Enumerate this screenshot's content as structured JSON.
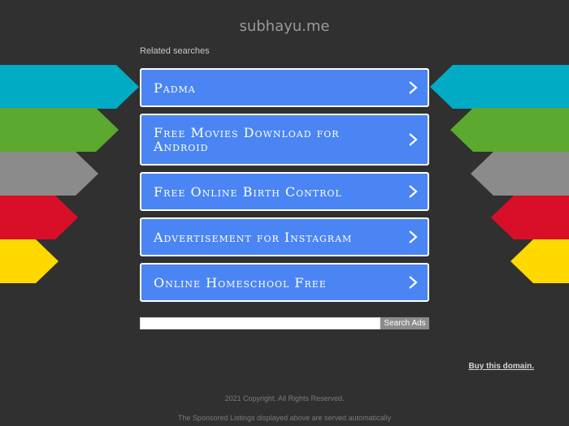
{
  "site": {
    "title": "subhayu.me"
  },
  "related": {
    "heading": "Related searches",
    "items": [
      {
        "label": "Padma"
      },
      {
        "label": "Free Movies Download for Android"
      },
      {
        "label": "Free Online Birth Control"
      },
      {
        "label": "Advertisement for Instagram"
      },
      {
        "label": "Online Homeschool Free"
      }
    ]
  },
  "decor": {
    "arrow_colors": [
      "#00abc3",
      "#5ba92f",
      "#8b8b8b",
      "#d90f2a",
      "#ffd800"
    ]
  },
  "search": {
    "value": "",
    "button_label": "Search Ads"
  },
  "footer": {
    "buy_link": "Buy this domain.",
    "copyright": "2021 Copyright. All Rights Reserved.",
    "disclaimer": "The Sponsored Listings displayed above are served automatically"
  }
}
